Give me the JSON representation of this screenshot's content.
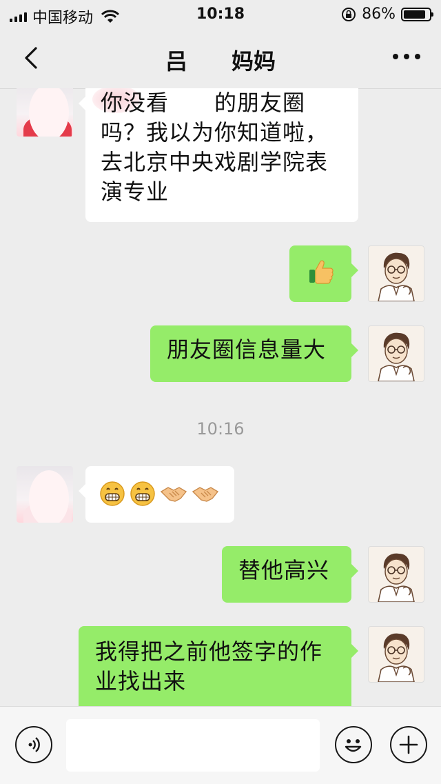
{
  "status_bar": {
    "carrier": "中国移动",
    "time": "10:18",
    "battery": "86%",
    "battery_level": 0.86
  },
  "header": {
    "title": "吕　　妈妈"
  },
  "messages": [
    {
      "from": "peer",
      "text": "你没看　　的朋友圈吗？我以为你知道啦，去北京中央戏剧学院表演专业"
    },
    {
      "from": "me",
      "emoji": [
        "thumbs-up"
      ]
    },
    {
      "from": "me",
      "text": "朋友圈信息量大"
    },
    {
      "timestamp": "10:16"
    },
    {
      "from": "peer",
      "emoji": [
        "grinning-face",
        "grinning-face",
        "handshake",
        "handshake"
      ]
    },
    {
      "from": "me",
      "text": "替他高兴"
    },
    {
      "from": "me",
      "text": "我得把之前他签字的作业找出来"
    }
  ],
  "colors": {
    "background": "#ededed",
    "outgoing_bubble": "#95ec69",
    "incoming_bubble": "#ffffff"
  },
  "input_bar": {
    "value": "",
    "icons": [
      "voice-icon",
      "emoji-icon",
      "plus-icon"
    ]
  }
}
